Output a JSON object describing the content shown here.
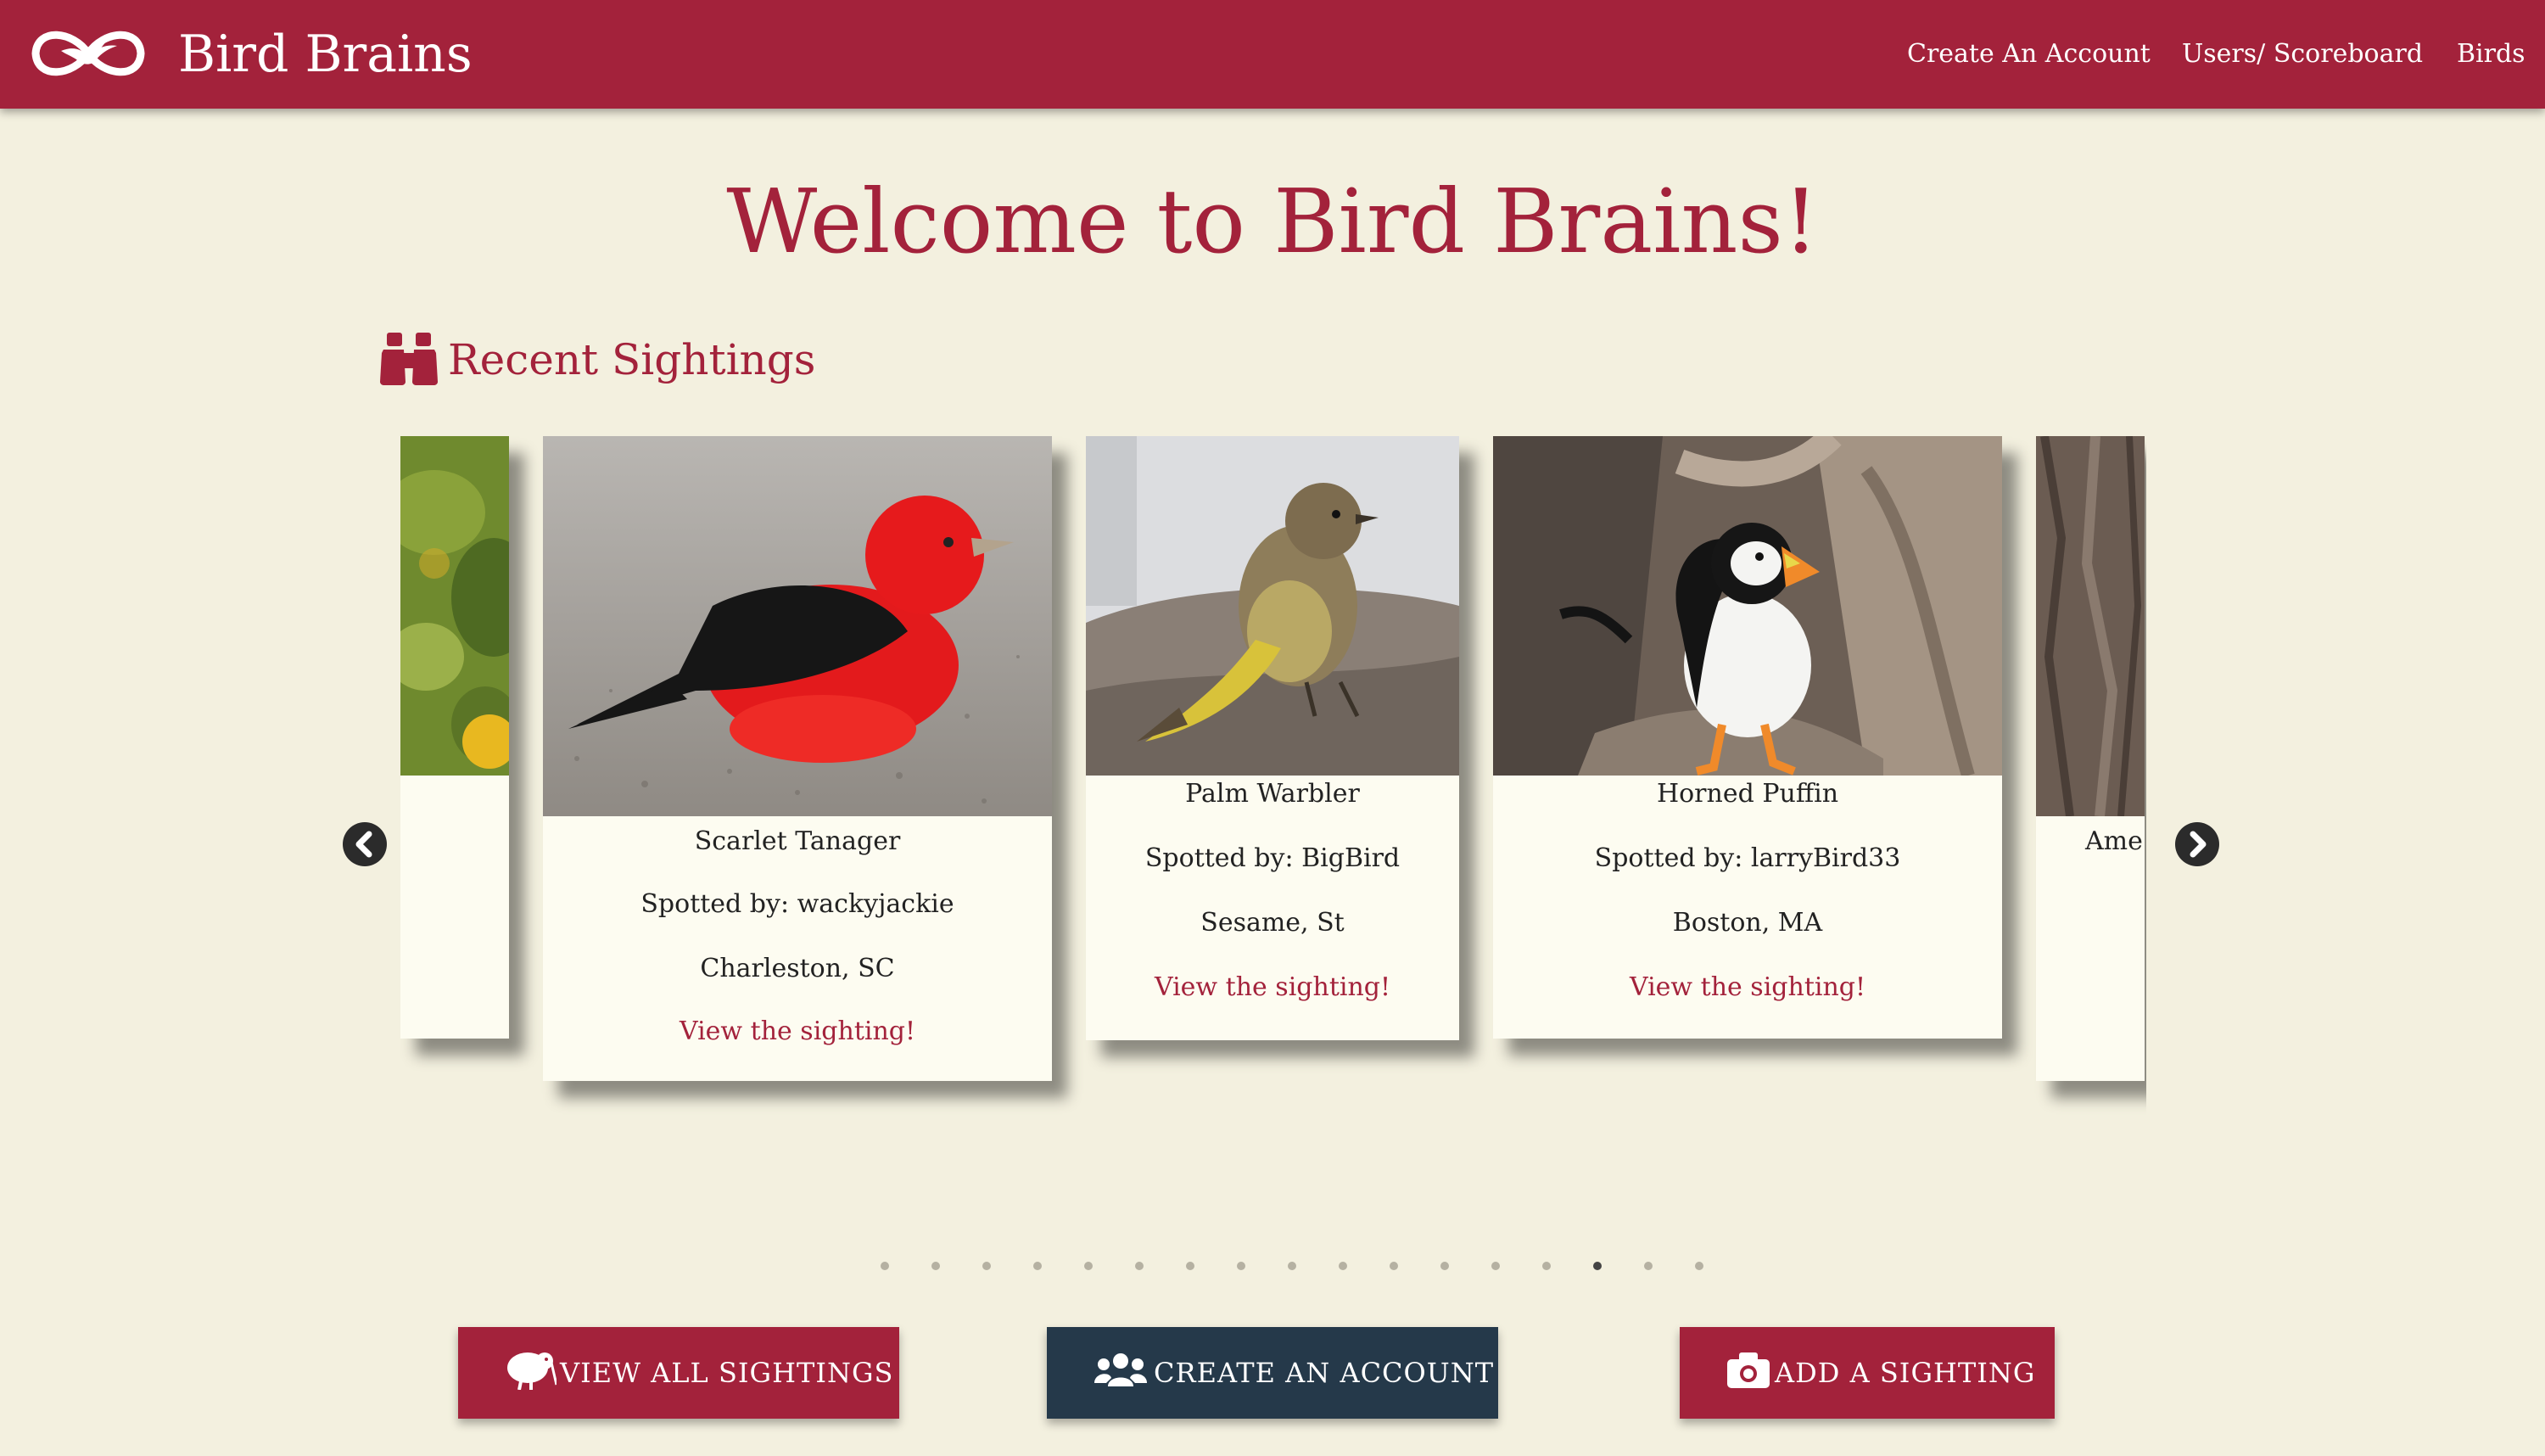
{
  "brand": {
    "name": "Bird Brains",
    "logo_icon": "bird-infinity-logo-icon"
  },
  "nav": {
    "links": [
      "Create An Account",
      "Users/ Scoreboard",
      "Birds"
    ]
  },
  "hero": {
    "title": "Welcome to Bird Brains!"
  },
  "recent": {
    "heading": "Recent Sightings",
    "icon": "binoculars-icon",
    "cards": [
      {
        "bird": "",
        "spotted_by": "",
        "location": "",
        "link": ""
      },
      {
        "bird": "Scarlet Tanager",
        "spotted_by": "Spotted by: wackyjackie",
        "location": "Charleston, SC",
        "link": "View the sighting!"
      },
      {
        "bird": "Palm Warbler",
        "spotted_by": "Spotted by: BigBird",
        "location": "Sesame, St",
        "link": "View the sighting!"
      },
      {
        "bird": "Horned Puffin",
        "spotted_by": "Spotted by: larryBird33",
        "location": "Boston, MA",
        "link": "View the sighting!"
      },
      {
        "bird": "Ame",
        "spotted_by": "",
        "location": "",
        "link": ""
      }
    ],
    "dots_total": 17,
    "dot_active_index": 14
  },
  "actions": {
    "view_all": "VIEW ALL SIGHTINGS",
    "create_account": "CREATE AN ACCOUNT",
    "add_sighting": "ADD A SIGHTING"
  },
  "colors": {
    "brand": "#a3223b",
    "background": "#f3f0df",
    "card": "#fdfcf1",
    "dark_button": "#25394a"
  }
}
